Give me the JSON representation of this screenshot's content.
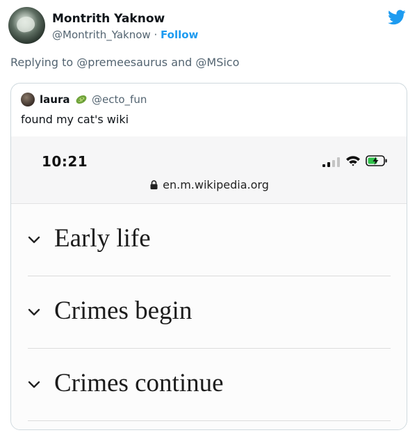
{
  "tweet": {
    "display_name": "Montrith Yaknow",
    "handle": "@Montrith_Yaknow",
    "separator": "·",
    "follow_label": "Follow",
    "replying_to": "Replying to @premeesaurus and @MSico",
    "brand_color": "#1d9bf0",
    "brand_icon": "twitter-bird-icon"
  },
  "quote": {
    "name": "laura",
    "emoji_icon": "cucumber-emoji",
    "handle": "@ecto_fun",
    "text": "found my cat's wiki"
  },
  "phone": {
    "time": "10:21",
    "url": "en.m.wikipedia.org",
    "sections": [
      {
        "title": "Early life",
        "icon": "chevron-down-icon"
      },
      {
        "title": "Crimes begin",
        "icon": "chevron-down-icon"
      },
      {
        "title": "Crimes continue",
        "icon": "chevron-down-icon"
      }
    ]
  }
}
